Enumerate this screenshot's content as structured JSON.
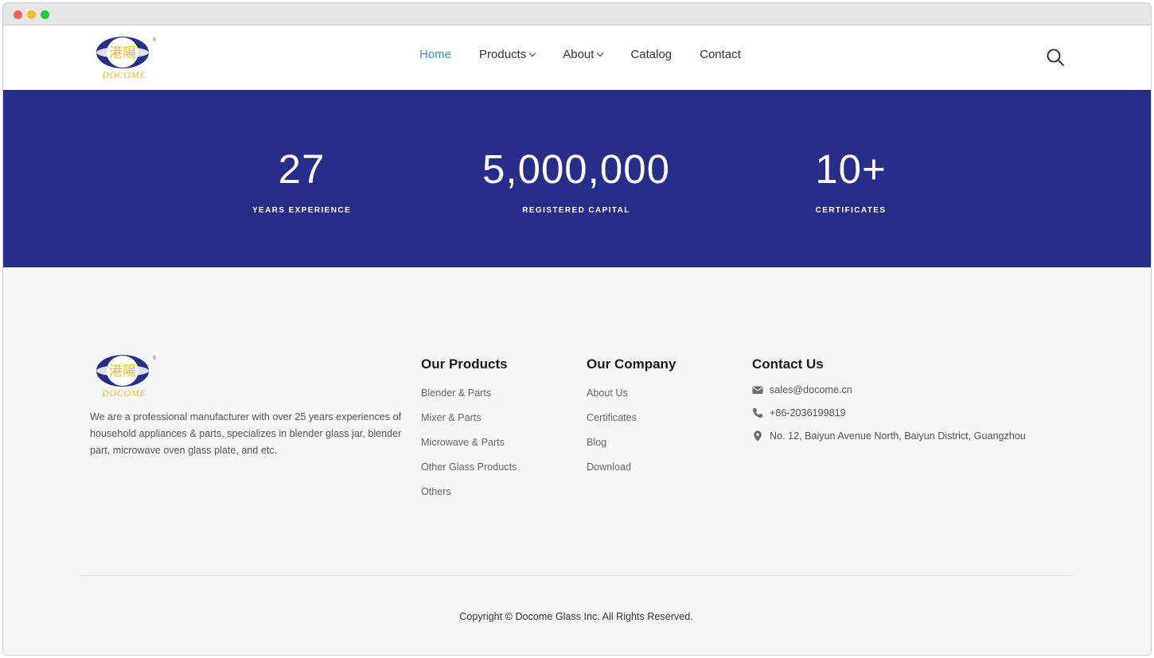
{
  "brand": {
    "logo_glyph": "港陽",
    "logo_text": "DOCOME",
    "logo_mark": "®",
    "primary_color": "#282d88",
    "accent_color": "#e8b923"
  },
  "nav": {
    "items": [
      {
        "label": "Home",
        "active": true,
        "has_dropdown": false
      },
      {
        "label": "Products",
        "active": false,
        "has_dropdown": true
      },
      {
        "label": "About",
        "active": false,
        "has_dropdown": true
      },
      {
        "label": "Catalog",
        "active": false,
        "has_dropdown": false
      },
      {
        "label": "Contact",
        "active": false,
        "has_dropdown": false
      }
    ],
    "search_icon": "search-icon"
  },
  "stats": [
    {
      "value": "27",
      "label": "YEARS EXPERIENCE"
    },
    {
      "value": "5,000,000",
      "label": "REGISTERED CAPITAL"
    },
    {
      "value": "10+",
      "label": "CERTIFICATES"
    }
  ],
  "footer": {
    "description": "We are a professional manufacturer with over 25 years experiences of household appliances & parts, specializes in blender glass jar, blender part, microwave oven glass plate, and etc.",
    "products": {
      "title": "Our Products",
      "links": [
        "Blender & Parts",
        "Mixer & Parts",
        "Microwave & Parts",
        "Other Glass Products",
        "Others"
      ]
    },
    "company": {
      "title": "Our Company",
      "links": [
        "About Us",
        "Certificates",
        "Blog",
        "Download"
      ]
    },
    "contact": {
      "title": "Contact Us",
      "email": "sales@docome.cn",
      "phone": "+86-2036199819",
      "address": "No. 12, Baiyun Avenue North, Baiyun District, Guangzhou"
    },
    "copyright": "Copyright © Docome Glass Inc. All Rights Reserved."
  }
}
